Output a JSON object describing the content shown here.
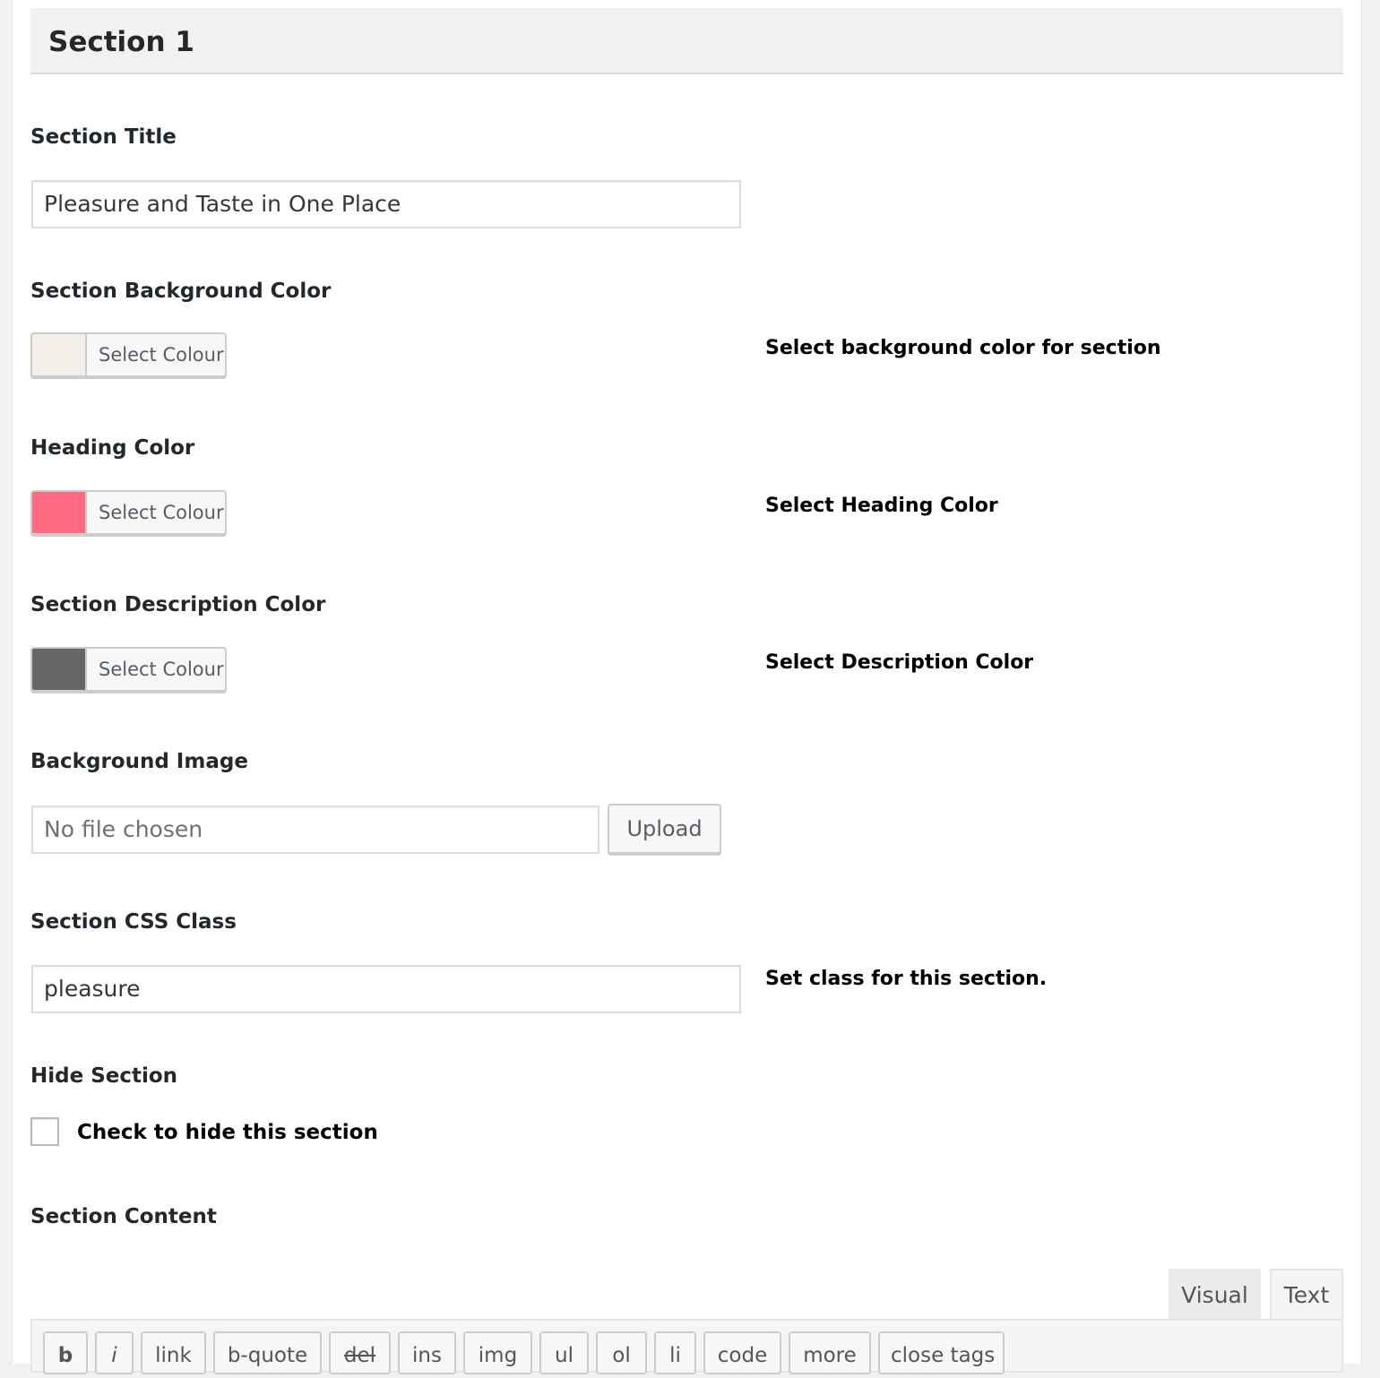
{
  "section": {
    "title": "Section 1"
  },
  "fields": {
    "section_title": {
      "label": "Section Title",
      "value": "Pleasure and Taste in One Place"
    },
    "bg_color": {
      "label": "Section Background Color",
      "button_label": "Select Colour",
      "swatch": "#f2efe9",
      "description": "Select background color for section"
    },
    "heading_color": {
      "label": "Heading Color",
      "button_label": "Select Colour",
      "swatch": "#ff6982",
      "description": "Select Heading Color"
    },
    "desc_color": {
      "label": "Section Description Color",
      "button_label": "Select Colour",
      "swatch": "#666666",
      "description": "Select Description Color"
    },
    "bg_image": {
      "label": "Background Image",
      "placeholder": "No file chosen",
      "button_label": "Upload"
    },
    "css_class": {
      "label": "Section CSS Class",
      "value": "pleasure",
      "description": "Set class for this section."
    },
    "hide_section": {
      "label": "Hide Section",
      "checkbox_label": "Check to hide this section",
      "checked": false
    },
    "content": {
      "label": "Section Content"
    }
  },
  "editor": {
    "tabs": [
      "Visual",
      "Text"
    ],
    "active_tab": "Text",
    "quicktags": [
      "b",
      "i",
      "link",
      "b-quote",
      "del",
      "ins",
      "img",
      "ul",
      "ol",
      "li",
      "code",
      "more",
      "close tags"
    ]
  }
}
